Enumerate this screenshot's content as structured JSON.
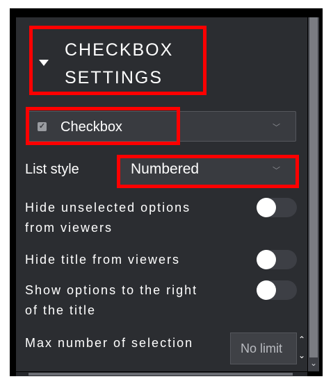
{
  "section": {
    "title_line1": "CHECKBOX",
    "title_line2": "SETTINGS"
  },
  "type_select": {
    "value": "Checkbox",
    "icon": "checkbox-checked-icon"
  },
  "list_style": {
    "label": "List style",
    "value": "Numbered"
  },
  "toggles": [
    {
      "label_line1": "Hide unselected options",
      "label_line2": "from viewers",
      "on": false
    },
    {
      "label_line1": "Hide title from viewers",
      "label_line2": "",
      "on": false
    },
    {
      "label_line1": "Show options to the right",
      "label_line2": "of the title",
      "on": false
    }
  ],
  "max_selection": {
    "label": "Max number of selection",
    "value": "No limit"
  },
  "colors": {
    "panel_bg": "#2b2d31",
    "highlight": "#ff0000",
    "toggle_track": "#3d3f45",
    "toggle_knob": "#ffffff"
  }
}
